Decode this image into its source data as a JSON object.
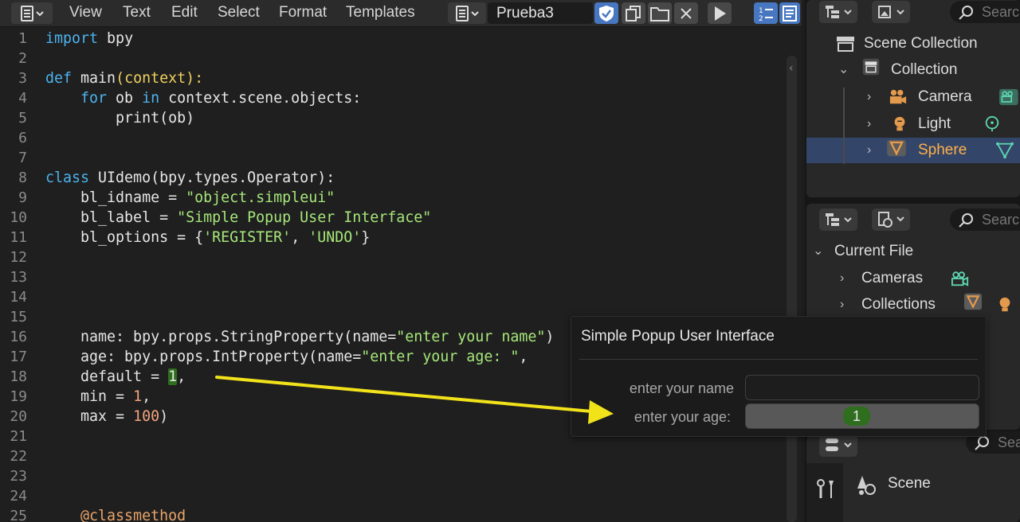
{
  "header": {
    "menu": [
      "View",
      "Text",
      "Edit",
      "Select",
      "Format",
      "Templates"
    ],
    "file_name": "Prueba3"
  },
  "line_numbers": [
    "1",
    "2",
    "3",
    "4",
    "5",
    "6",
    "7",
    "8",
    "9",
    "10",
    "11",
    "12",
    "13",
    "14",
    "15",
    "16",
    "17",
    "18",
    "19",
    "20",
    "21",
    "22",
    "23",
    "24",
    "25"
  ],
  "code": {
    "l1_a": "import",
    "l1_b": " bpy",
    "l3_a": "def",
    "l3_b": " main",
    "l3_c": "(context):",
    "l4_a": "    for",
    "l4_b": " ob ",
    "l4_c": "in",
    "l4_d": " context.scene.objects:",
    "l5_a": "        print",
    "l5_b": "(ob)",
    "l8_a": "class",
    "l8_b": " UIdemo(bpy.types.Operator):",
    "l9_a": "    bl_idname = ",
    "l9_b": "\"object.simpleui\"",
    "l10_a": "    bl_label = ",
    "l10_b": "\"Simple Popup User Interface\"",
    "l11_a": "    bl_options = {",
    "l11_b": "'REGISTER'",
    "l11_c": ", ",
    "l11_d": "'UNDO'",
    "l11_e": "}",
    "l16_a": "    name: bpy.props.StringProperty(name=",
    "l16_b": "\"enter your name\"",
    "l16_c": ")",
    "l17_a": "    age: bpy.props.IntProperty(name=",
    "l17_b": "\"enter your age: \"",
    "l17_c": ",",
    "l18_a": "    default = ",
    "l18_b": "1",
    "l18_c": ",",
    "l19_a": "    min = ",
    "l19_b": "1",
    "l19_c": ",",
    "l20_a": "    max = ",
    "l20_b": "100",
    "l20_c": ")",
    "l25_a": "    @classmethod"
  },
  "outliner": {
    "search_placeholder": "Search",
    "scene_collection": "Scene Collection",
    "collection": "Collection",
    "items": [
      "Camera",
      "Light",
      "Sphere"
    ]
  },
  "blend_file": {
    "search_placeholder": "Search",
    "current_file": "Current File",
    "items": [
      "Cameras",
      "Collections"
    ]
  },
  "properties": {
    "search_placeholder": "Search",
    "scene_label": "Scene"
  },
  "popup": {
    "title": "Simple Popup User Interface",
    "name_label": "enter your name",
    "name_value": "",
    "age_label": "enter your age:",
    "age_value": "1"
  },
  "colors": {
    "keyword": "#4cb3ee",
    "string": "#a6e77a",
    "number": "#f4a37e",
    "selected_row": "#334669",
    "selected_text": "#ffaf4a",
    "annotation": "#f2e21a"
  }
}
